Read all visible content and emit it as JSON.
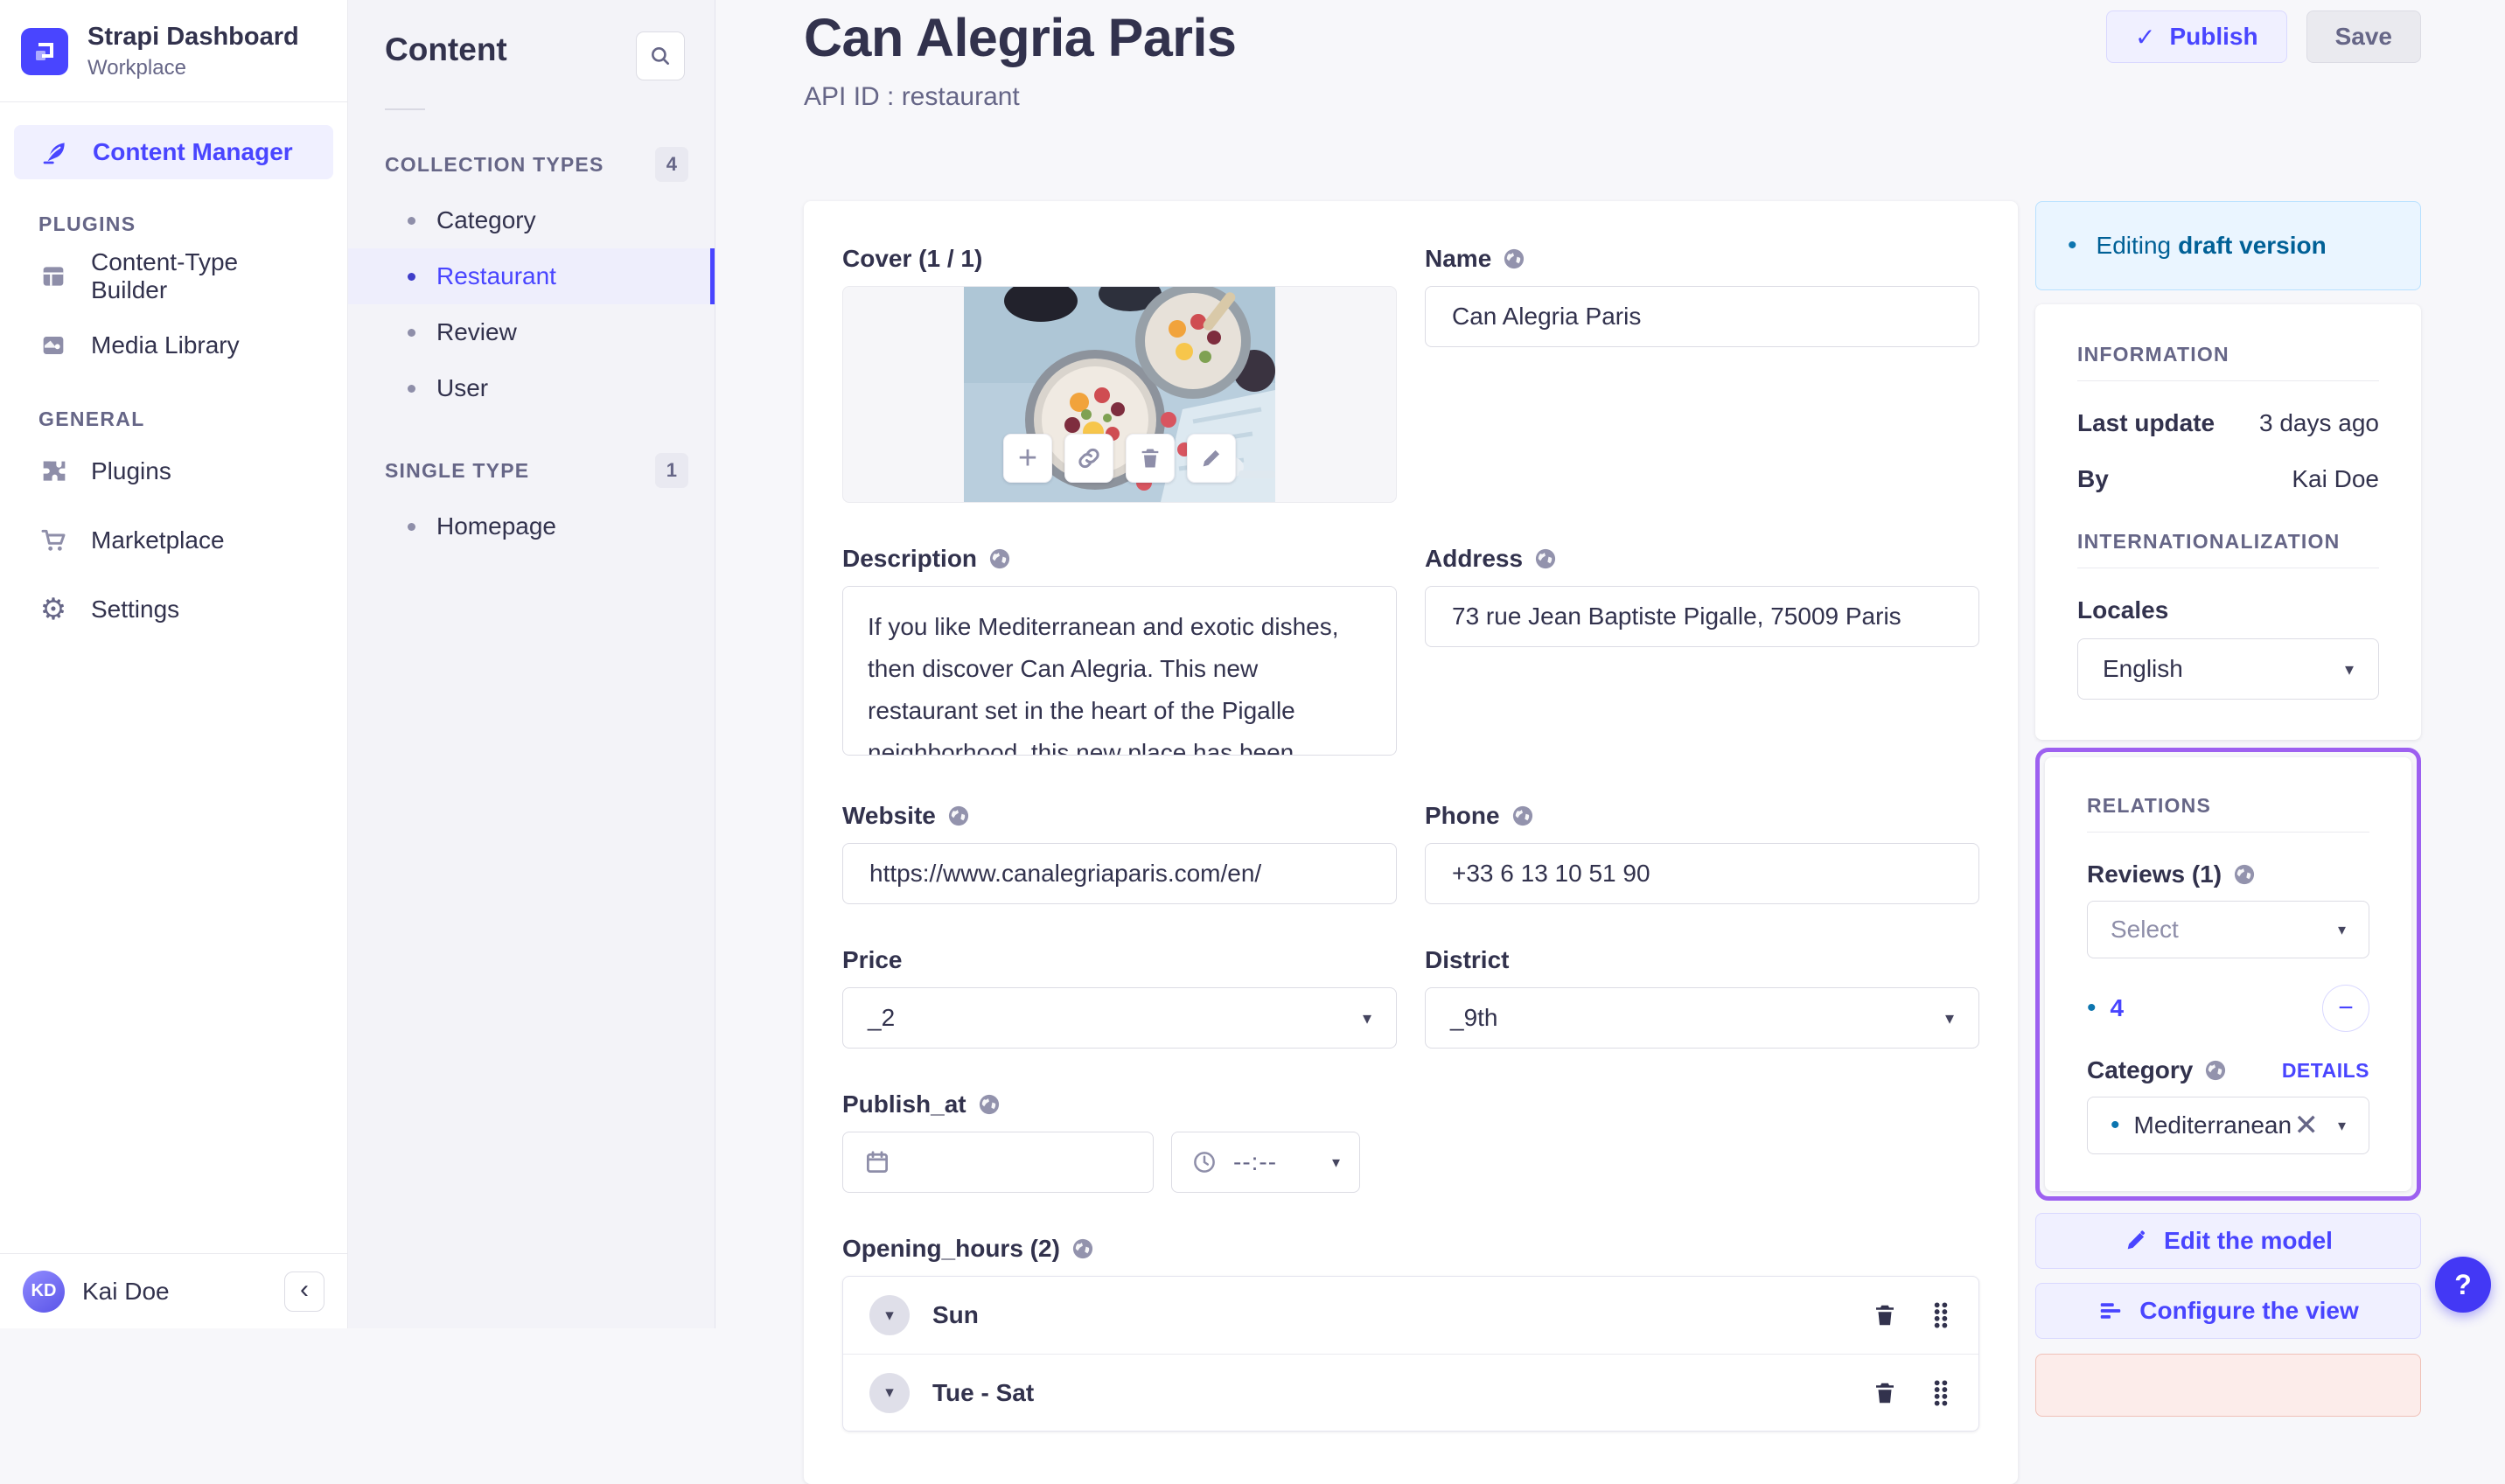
{
  "colors": {
    "accent": "#4945ff",
    "accent_light_bg": "#f0f0ff",
    "accent_border": "#d9d8ff",
    "draft_bg": "#eaf5ff",
    "draft_border": "#b8e1ff",
    "draft_text": "#006096",
    "highlight_purple": "#9d60f0",
    "danger_bg": "#fcecea",
    "danger_border": "#f0c1b8",
    "text_dark": "#32324d",
    "text_gray": "#666687"
  },
  "glyphs": {
    "check": "✓",
    "caret_down": "▾",
    "close": "✕",
    "minus": "−",
    "plus": "+",
    "collapse": "‹",
    "help": "?",
    "dot": "•",
    "gear": "⚙"
  },
  "app": {
    "brand": {
      "title": "Strapi Dashboard",
      "subtitle": "Workplace"
    },
    "nav": {
      "content_manager": "Content Manager",
      "sections": [
        {
          "label": "PLUGINS",
          "items": [
            {
              "label": "Content-Type Builder"
            },
            {
              "label": "Media Library"
            }
          ]
        },
        {
          "label": "GENERAL",
          "items": [
            {
              "label": "Plugins"
            },
            {
              "label": "Marketplace"
            },
            {
              "label": "Settings"
            }
          ]
        }
      ],
      "user": {
        "name": "Kai Doe",
        "initials": "KD"
      }
    }
  },
  "subnav": {
    "title": "Content",
    "groups": [
      {
        "label": "COLLECTION TYPES",
        "count": "4",
        "items": [
          "Category",
          "Restaurant",
          "Review",
          "User"
        ],
        "active_item": "Restaurant"
      },
      {
        "label": "SINGLE TYPE",
        "count": "1",
        "items": [
          "Homepage"
        ]
      }
    ]
  },
  "header": {
    "title": "Can Alegria Paris",
    "subtitle": "API ID : restaurant",
    "publish": "Publish",
    "save": "Save"
  },
  "form": {
    "cover": {
      "label": "Cover (1 / 1)"
    },
    "name": {
      "label": "Name",
      "value": "Can Alegria Paris"
    },
    "description": {
      "label": "Description",
      "value": "If you like Mediterranean and exotic dishes, then discover Can Alegria. This new restaurant set in the heart of the Pigalle neighborhood, this new place has been designed by Marc-Antoine"
    },
    "address": {
      "label": "Address",
      "value": "73 rue Jean Baptiste Pigalle, 75009 Paris"
    },
    "website": {
      "label": "Website",
      "value": "https://www.canalegriaparis.com/en/"
    },
    "phone": {
      "label": "Phone",
      "value": "+33 6 13 10 51 90"
    },
    "price": {
      "label": "Price",
      "value": "_2"
    },
    "district": {
      "label": "District",
      "value": "_9th"
    },
    "publish_at": {
      "label": "Publish_at",
      "date_value": "",
      "time_value": "--:--"
    },
    "opening_hours": {
      "label": "Opening_hours (2)",
      "rows": [
        {
          "title": "Sun"
        },
        {
          "title": "Tue - Sat"
        }
      ]
    }
  },
  "panel": {
    "draft": {
      "prefix": "Editing",
      "emphasis": "draft version"
    },
    "information": {
      "title": "INFORMATION",
      "rows": [
        {
          "label": "Last update",
          "value": "3 days ago"
        },
        {
          "label": "By",
          "value": "Kai Doe"
        }
      ]
    },
    "i18n": {
      "title": "INTERNATIONALIZATION",
      "locales_label": "Locales",
      "locale": "English"
    },
    "relations": {
      "title": "RELATIONS",
      "reviews_label": "Reviews (1)",
      "reviews_placeholder": "Select",
      "count_badge": "4",
      "category_label": "Category",
      "details": "DETAILS",
      "category_value": "Mediterranean"
    },
    "actions": [
      {
        "label": "Edit the model"
      },
      {
        "label": "Configure the view"
      }
    ]
  }
}
